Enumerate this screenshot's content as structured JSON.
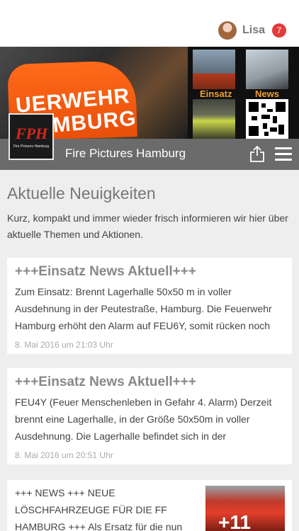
{
  "header": {
    "user_name": "Lisa",
    "notification_count": "7"
  },
  "banner": {
    "jacket_line1": "UERWEHR",
    "jacket_line2": "HAMBURG",
    "label_einsatz": "Einsatz",
    "label_news": "News",
    "logo_text": "FPH",
    "logo_sub": "Fire Pictures Hamburg"
  },
  "appbar": {
    "title": "Fire Pictures Hamburg"
  },
  "main": {
    "title": "Aktuelle Neuigkeiten",
    "description": "Kurz, kompakt und immer wieder frisch informieren wir hier über aktuelle Themen und Aktionen."
  },
  "posts": [
    {
      "title": "+++Einsatz News Aktuell+++",
      "excerpt": "Zum Einsatz: Brennt Lagerhalle 50x50 m in voller Ausdehnung in der Peutestraße, Hamburg. Die Feuerwehr Hamburg erhöht den Alarm auf FEU6Y, somit rücken noch",
      "date": "8. Mai 2016 um 21:03 Uhr"
    },
    {
      "title": "+++Einsatz News Aktuell+++",
      "excerpt": "FEU4Y (Feuer Menschenleben in Gefahr 4. Alarm) Derzeit brennt eine Lagerhalle, in der Größe 50x50m in voller Ausdehnung. Die Lagerhalle befindet sich in der Peutestraße,",
      "date": "8. Mai 2016 um 20:51 Uhr"
    },
    {
      "excerpt": "+++ NEWS +++ NEUE LÖSCHFAHRZEUGE FÜR DIE FF HAMBURG +++ Als Ersatz für die nun",
      "image_overlay": "+11"
    }
  ],
  "colors": {
    "appbar": "#6b6b6b",
    "badge": "#e23b3b",
    "background": "#eeeeee"
  }
}
